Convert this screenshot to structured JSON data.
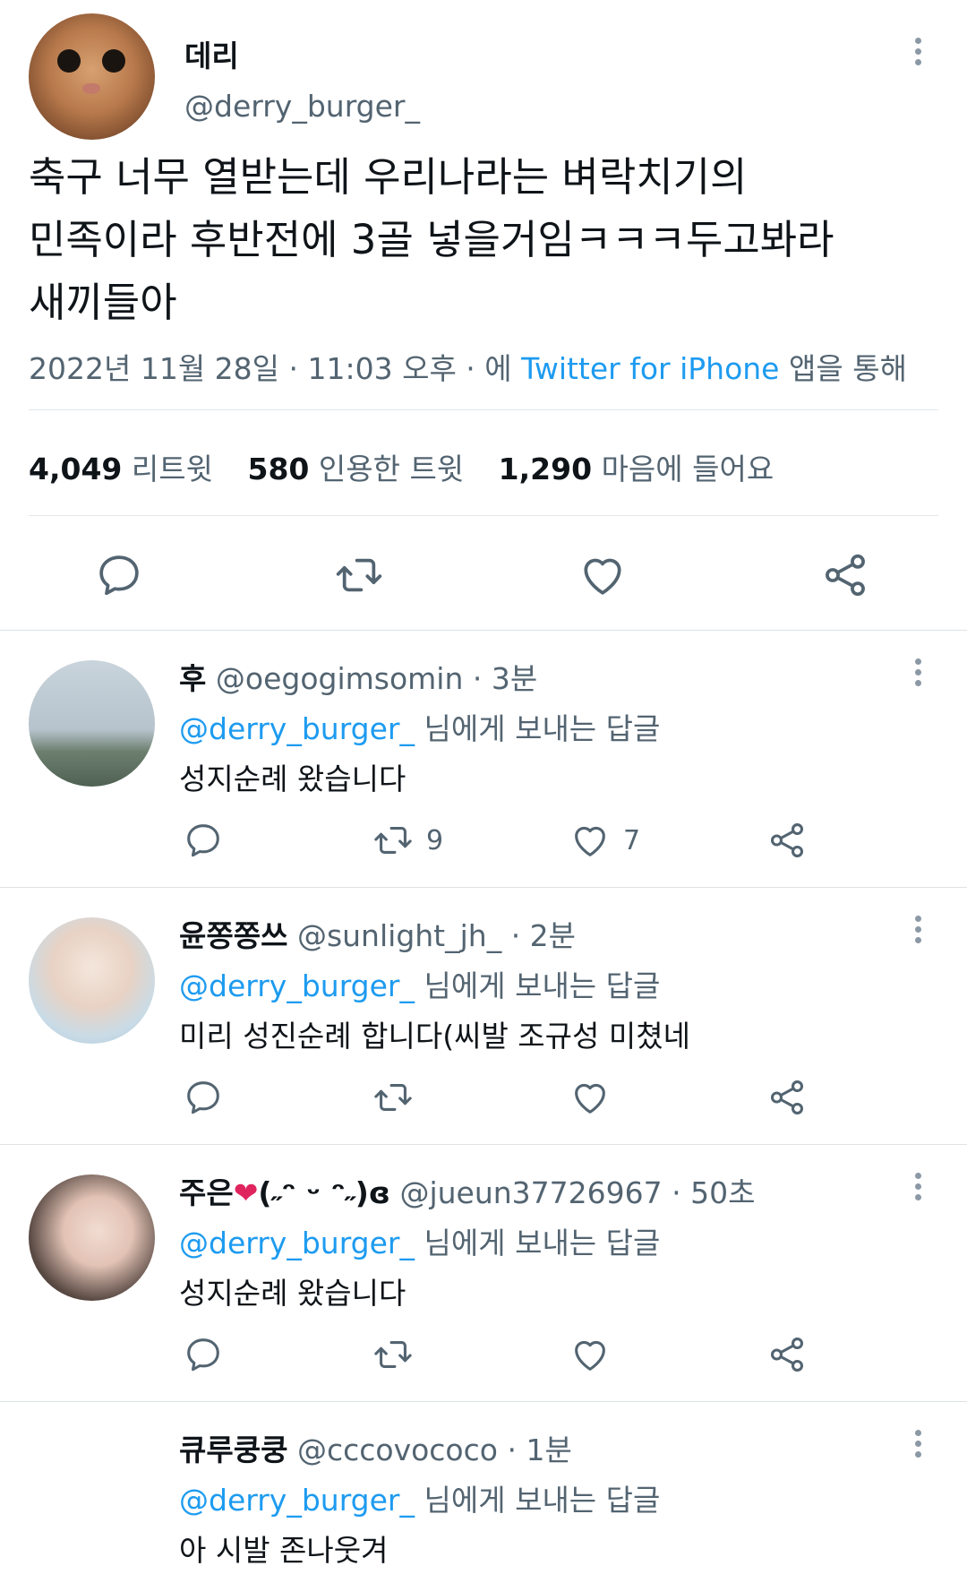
{
  "tweet": {
    "name": "데리",
    "handle": "@derry_burger_",
    "text_lines": [
      "축구 너무 열받는데 우리나라는 벼락치기의",
      "민족이라 후반전에 3골 넣을거임ㅋㅋㅋ두고봐라",
      "새끼들아"
    ],
    "timestamp": "2022년 11월 28일 · 11:03 오후 · 에",
    "source": "Twitter for iPhone",
    "source_suffix": "앱을 통해",
    "retweets": "4,049",
    "retweets_label": "리트윗",
    "quotes": "580",
    "quotes_label": "인용한 트윗",
    "likes": "1,290",
    "likes_label": "마음에 들어요"
  },
  "replying_prefix": "@derry_burger_",
  "replying_suffix": "님에게 보내는 답글",
  "replies": [
    {
      "name": "후",
      "handle": "@oegogimsomin",
      "time": "· 3분",
      "text": "성지순례 왔습니다",
      "retweets": "9",
      "likes": "7"
    },
    {
      "name": "윤쫑쫑쓰",
      "handle": "@sunlight_jh_",
      "time": "· 2분",
      "text": "미리 성진순례 합니다(씨발 조규성 미쳤네",
      "retweets": "",
      "likes": ""
    },
    {
      "name": "주은",
      "name_suffix": "(˶ᵔ ᵕ ᵔ˶)ɞ",
      "handle": "@jueun37726967",
      "time": "· 50초",
      "text": "성지순례 왔습니다",
      "retweets": "",
      "likes": ""
    },
    {
      "name": "큐루쿵쿵",
      "handle": "@cccovococo",
      "time": "· 1분",
      "text": "아 시발 존나웃겨",
      "retweets": "",
      "likes": ""
    }
  ],
  "colors": {
    "link": "#1d9bf0",
    "secondary_text": "#536471",
    "heart_red": "#e0245e"
  },
  "icons": [
    "more-icon",
    "reply-icon",
    "retweet-icon",
    "like-icon",
    "share-icon"
  ]
}
